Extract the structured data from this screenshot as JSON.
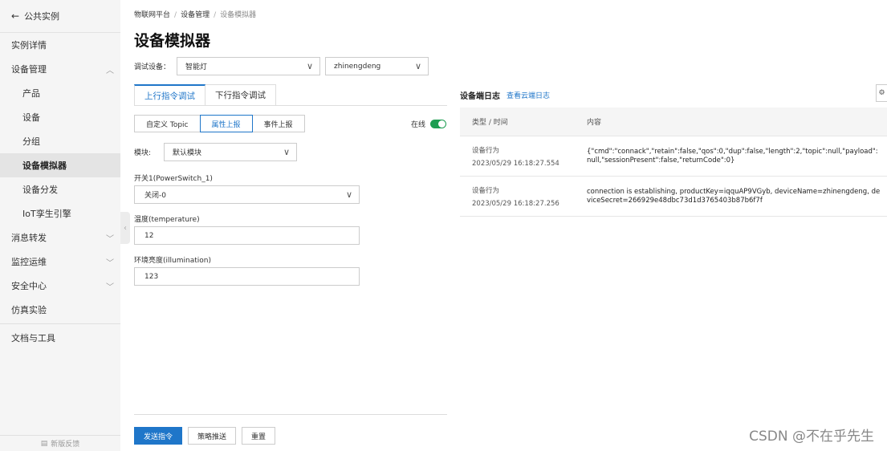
{
  "sidebar": {
    "back_label": "公共实例",
    "items": [
      {
        "label": "实例详情"
      },
      {
        "label": "设备管理"
      },
      {
        "label": "产品"
      },
      {
        "label": "设备"
      },
      {
        "label": "分组"
      },
      {
        "label": "设备模拟器"
      },
      {
        "label": "设备分发"
      },
      {
        "label": "IoT孪生引擎"
      },
      {
        "label": "消息转发"
      },
      {
        "label": "监控运维"
      },
      {
        "label": "安全中心"
      },
      {
        "label": "仿真实验"
      },
      {
        "label": "文档与工具"
      }
    ],
    "footer": "新版反馈"
  },
  "breadcrumb": [
    "物联网平台",
    "设备管理",
    "设备模拟器"
  ],
  "page_title": "设备模拟器",
  "device": {
    "label": "调试设备：",
    "product": "智能灯",
    "name": "zhinengdeng"
  },
  "tabs": [
    "上行指令调试",
    "下行指令调试"
  ],
  "segments": [
    "自定义 Topic",
    "属性上报",
    "事件上报"
  ],
  "online_label": "在线",
  "module": {
    "label": "模块:",
    "value": "默认模块"
  },
  "fields": {
    "switch": {
      "label": "开关1(PowerSwitch_1)",
      "value": "关闭-0"
    },
    "temperature": {
      "label": "温度(temperature)",
      "value": "12"
    },
    "illumination": {
      "label": "环境亮度(illumination)",
      "value": "123"
    }
  },
  "buttons": {
    "send": "发送指令",
    "policy": "策略推送",
    "reset": "重置"
  },
  "log": {
    "title": "设备端日志",
    "link": "查看云端日志",
    "headers": [
      "类型 / 时间",
      "内容"
    ],
    "rows": [
      {
        "type": "设备行为",
        "time": "2023/05/29 16:18:27.554",
        "content": "{\"cmd\":\"connack\",\"retain\":false,\"qos\":0,\"dup\":false,\"length\":2,\"topic\":null,\"payload\":null,\"sessionPresent\":false,\"returnCode\":0}"
      },
      {
        "type": "设备行为",
        "time": "2023/05/29 16:18:27.256",
        "content": "connection is establishing, productKey=iqquAP9VGyb, deviceName=zhinengdeng, deviceSecret=266929e48dbc73d1d3765403b87b6f7f"
      }
    ]
  },
  "watermark": "CSDN @不在乎先生"
}
